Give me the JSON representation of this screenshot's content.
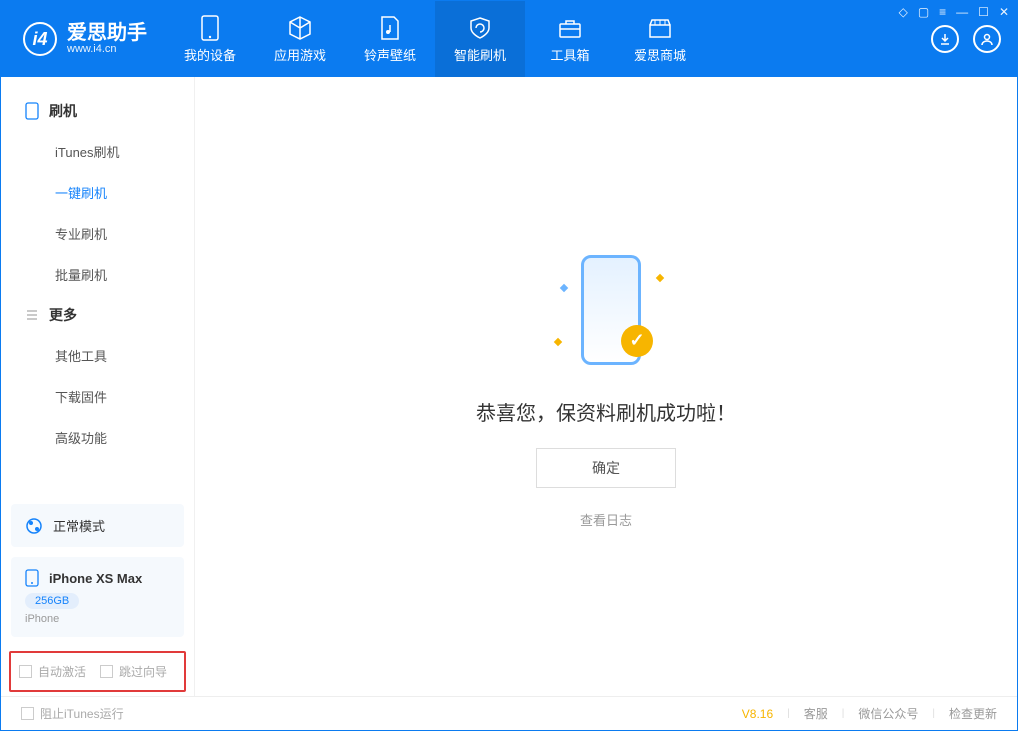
{
  "app": {
    "name_cn": "爱思助手",
    "name_en": "www.i4.cn"
  },
  "nav": {
    "items": [
      {
        "label": "我的设备"
      },
      {
        "label": "应用游戏"
      },
      {
        "label": "铃声壁纸"
      },
      {
        "label": "智能刷机"
      },
      {
        "label": "工具箱"
      },
      {
        "label": "爱思商城"
      }
    ]
  },
  "sidebar": {
    "section1": {
      "title": "刷机",
      "items": [
        "iTunes刷机",
        "一键刷机",
        "专业刷机",
        "批量刷机"
      ],
      "active_index": 1
    },
    "section2": {
      "title": "更多",
      "items": [
        "其他工具",
        "下载固件",
        "高级功能"
      ]
    },
    "mode_card": {
      "label": "正常模式"
    },
    "device_card": {
      "name": "iPhone XS Max",
      "capacity": "256GB",
      "type": "iPhone"
    },
    "checkboxes": {
      "auto_activate": "自动激活",
      "skip_wizard": "跳过向导"
    }
  },
  "main": {
    "success_message": "恭喜您，保资料刷机成功啦！",
    "ok_button": "确定",
    "view_log": "查看日志"
  },
  "footer": {
    "block_itunes": "阻止iTunes运行",
    "version": "V8.16",
    "links": [
      "客服",
      "微信公众号",
      "检查更新"
    ]
  }
}
